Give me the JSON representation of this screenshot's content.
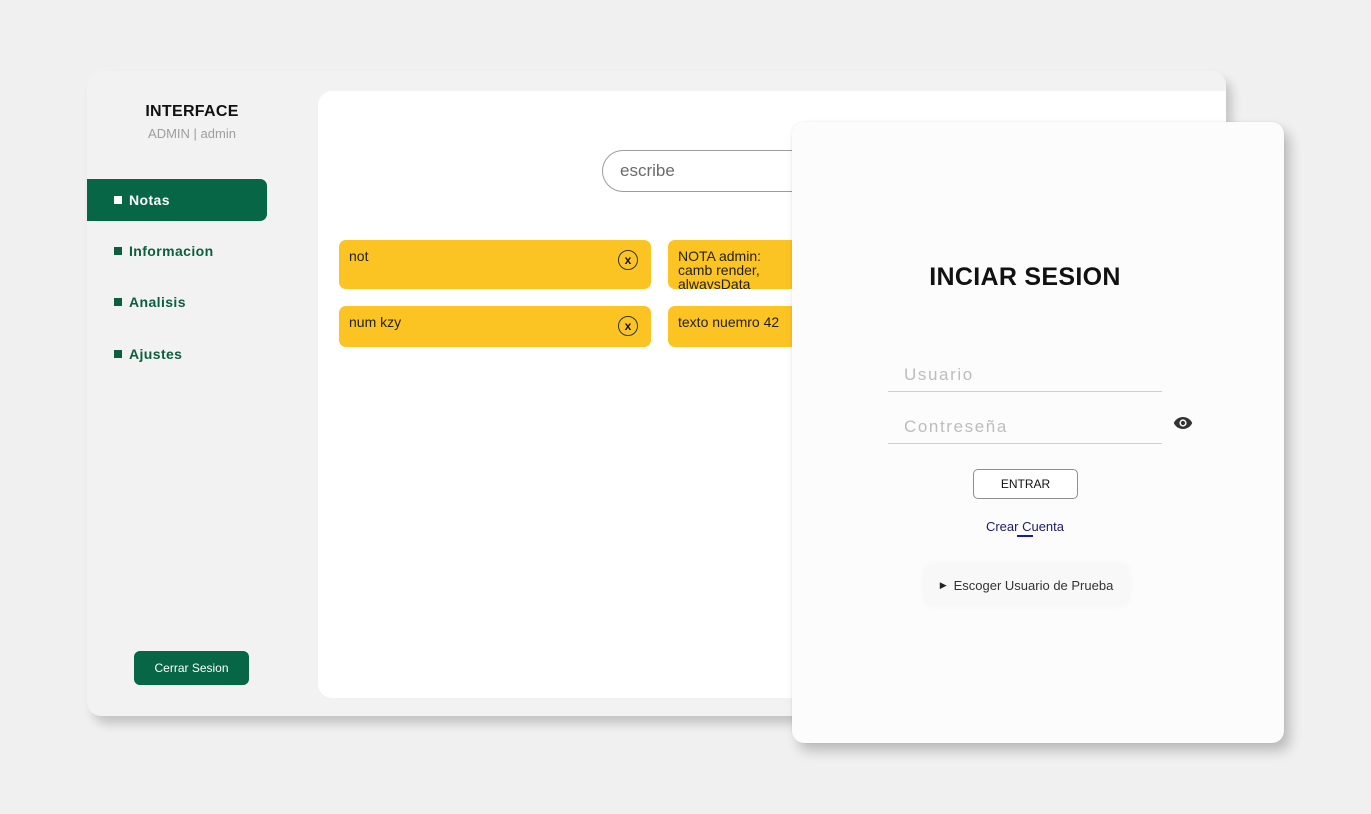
{
  "app": {
    "title": "INTERFACE",
    "subtitle": "ADMIN | admin"
  },
  "sidebar": {
    "items": [
      {
        "label": "Notas",
        "active": true
      },
      {
        "label": "Informacion",
        "active": false
      },
      {
        "label": "Analisis",
        "active": false
      },
      {
        "label": "Ajustes",
        "active": false
      }
    ],
    "logout_label": "Cerrar Sesion"
  },
  "search": {
    "placeholder": "escribe"
  },
  "notes": [
    {
      "text": "not",
      "close_label": "x"
    },
    {
      "text": "NOTA admin: camb render, alwaysData"
    },
    {
      "text": "num kzy",
      "close_label": "x"
    },
    {
      "text": "texto nuemro 42"
    }
  ],
  "login": {
    "title": "INCIAR SESION",
    "username_placeholder": "Usuario",
    "password_placeholder": "Contreseña",
    "enter_label": "ENTRAR",
    "create_account_label": "Crear Cuenta",
    "test_user_label": "Escoger Usuario de Prueba"
  },
  "colors": {
    "brand_green": "#066645",
    "note_yellow": "#fcc423",
    "background": "#f0f0f0"
  },
  "icons": {
    "bullet": "square-bullet-icon",
    "close": "close-circle-icon",
    "eye": "eye-icon",
    "disclosure": "triangle-right-icon"
  }
}
